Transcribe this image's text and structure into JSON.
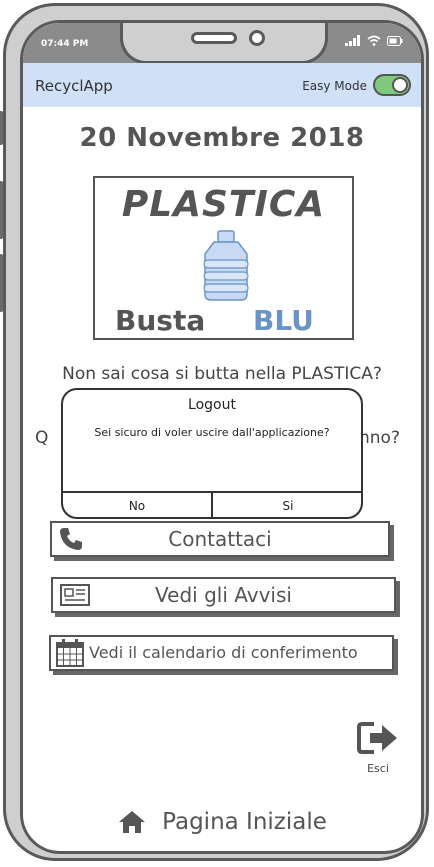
{
  "status_bar": {
    "time": "07:44 PM"
  },
  "app_bar": {
    "title": "RecyclApp",
    "easy_mode_label": "Easy Mode",
    "easy_mode_on": true
  },
  "date": "20 Novembre 2018",
  "bin_card": {
    "material": "PLASTICA",
    "bag_label": "Busta",
    "bag_color_name": "BLU",
    "bag_color": "#6a93c6"
  },
  "questions": {
    "q1": "Non sai cosa si butta nella PLASTICA?",
    "q2_start": "Q",
    "q2_end": "nno?"
  },
  "logout_dialog": {
    "title": "Logout",
    "message": "Sei sicuro di voler uscire dall'applicazione?",
    "no_label": "No",
    "yes_label": "Si"
  },
  "actions": {
    "contact_label": "Contattaci",
    "notices_label": "Vedi gli Avvisi",
    "calendar_label": "Vedi il calendario di conferimento"
  },
  "exit": {
    "label": "Esci"
  },
  "home": {
    "label": "Pagina Iniziale"
  },
  "icons": {
    "phone": "phone-icon",
    "newspaper": "newspaper-icon",
    "calendar": "calendar-icon",
    "exit": "exit-icon",
    "home": "home-icon"
  },
  "colors": {
    "appbar": "#cfe0f7",
    "toggle_on": "#7fc97f",
    "accent_blue": "#6a93c6"
  }
}
